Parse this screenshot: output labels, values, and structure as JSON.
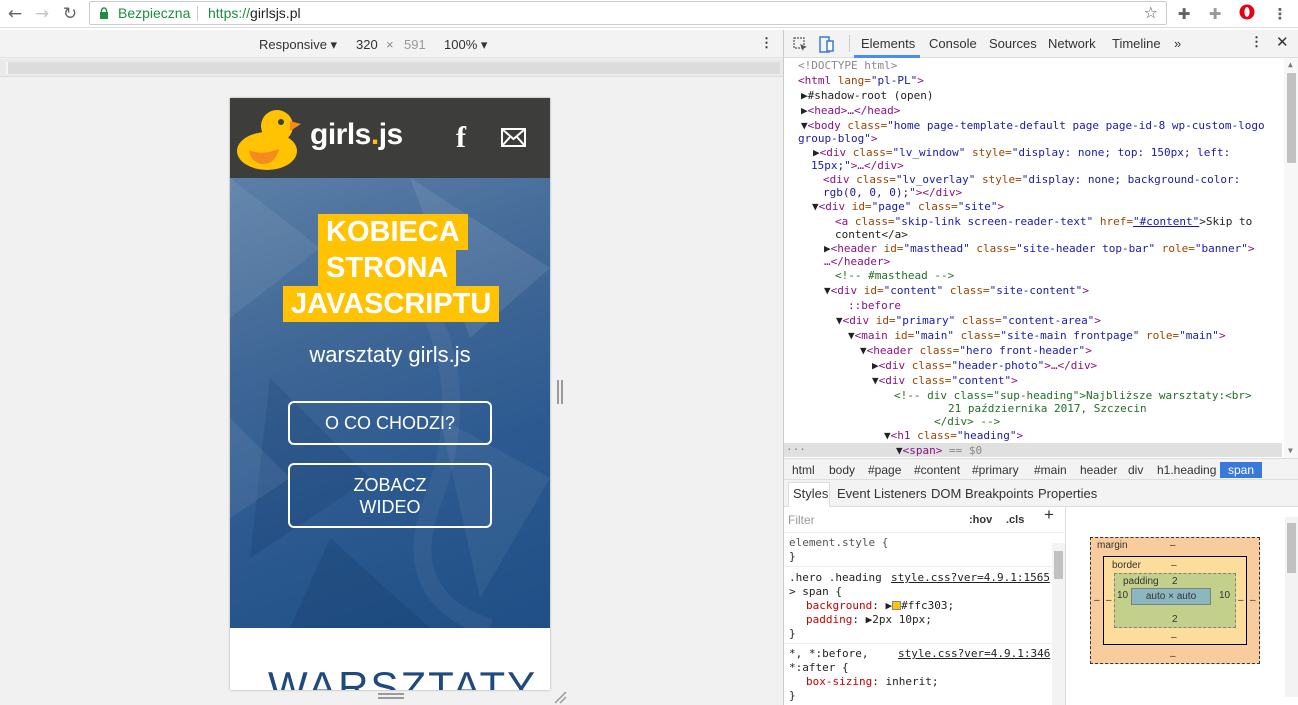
{
  "browser": {
    "secure_label": "Bezpieczna",
    "url_proto": "https://",
    "url_host": "girlsjs.pl"
  },
  "device_toolbar": {
    "device": "Responsive",
    "width": "320",
    "times": "×",
    "height": "591",
    "zoom": "100%"
  },
  "site": {
    "name_pre": "girls",
    "name_dot": ".",
    "name_post": "js",
    "hero_line1": "KOBIECA",
    "hero_line2": "STRONA",
    "hero_line3": "JAVASCRIPTU",
    "subtitle": "warsztaty girls.js",
    "button1": "O CO CHODZI?",
    "button2_line1": "ZOBACZ",
    "button2_line2": "WIDEO",
    "section_title": "WARSZTATY",
    "accent_color": "#ffc303"
  },
  "devtools": {
    "tabs": [
      "Elements",
      "Console",
      "Sources",
      "Network",
      "Timeline"
    ],
    "more": "»",
    "tree": {
      "doctype": "<!DOCTYPE html>",
      "html_open": "<html",
      "html_attr_name": " lang=",
      "html_attr_val": "\"pl-PL\"",
      "html_close": ">",
      "shadow": "#shadow-root (open)",
      "head": "<head>…</head>",
      "body_tag": "<body",
      "body_attr": " class=",
      "body_val1": "\"home page-template-default page page-id-8 wp-custom-logo",
      "body_val2": "group-blog\"",
      "body_close": ">",
      "lv_window_1a": "<div",
      "lv_window_1b": " class=",
      "lv_window_1c": "\"lv_window\"",
      "lv_window_1d": " style=",
      "lv_window_1e": "\"display: none; top: 150px; left:",
      "lv_window_2": "15px;\"",
      "lv_window_2b": ">…</div>",
      "lv_overlay_1a": "<div",
      "lv_overlay_1b": " class=",
      "lv_overlay_1c": "\"lv_overlay\"",
      "lv_overlay_1d": " style=",
      "lv_overlay_1e": "\"display: none; background-color:",
      "lv_overlay_2": "rgb(0, 0, 0);\"",
      "lv_overlay_2b": "></div>",
      "page_a": "<div",
      "page_b": " id=",
      "page_c": "\"page\"",
      "page_d": " class=",
      "page_e": "\"site\"",
      "page_f": ">",
      "skip_a": "<a",
      "skip_b": " class=",
      "skip_c": "\"skip-link screen-reader-text\"",
      "skip_d": " href=",
      "skip_e": "\"#content\"",
      "skip_f": ">Skip to",
      "skip_2": "content</a>",
      "header_a": "<header",
      "header_b": " id=",
      "header_c": "\"masthead\"",
      "header_d": " class=",
      "header_e": "\"site-header top-bar\"",
      "header_f": " role=",
      "header_g": "\"banner\"",
      "header_h": ">",
      "header_2": "…</header>",
      "masthead_comment": "<!-- #masthead -->",
      "content_a": "<div",
      "content_b": " id=",
      "content_c": "\"content\"",
      "content_d": " class=",
      "content_e": "\"site-content\"",
      "content_f": ">",
      "before": "::before",
      "primary_a": "<div",
      "primary_b": " id=",
      "primary_c": "\"primary\"",
      "primary_d": " class=",
      "primary_e": "\"content-area\"",
      "primary_f": ">",
      "main_a": "<main",
      "main_b": " id=",
      "main_c": "\"main\"",
      "main_d": " class=",
      "main_e": "\"site-main frontpage\"",
      "main_f": " role=",
      "main_g": "\"main\"",
      "main_h": ">",
      "hero_a": "<header",
      "hero_b": " class=",
      "hero_c": "\"hero front-header\"",
      "hero_d": ">",
      "photo_a": "<div",
      "photo_b": " class=",
      "photo_c": "\"header-photo\"",
      "photo_d": ">…</div>",
      "contentdiv_a": "<div",
      "contentdiv_b": " class=",
      "contentdiv_c": "\"content\"",
      "contentdiv_d": ">",
      "comment1": "<!-- div class=\"sup-heading\">Najbliższe warsztaty:<br>",
      "comment2": "21 października 2017, Szczecin",
      "comment3": "</div> -->",
      "h1_a": "<h1",
      "h1_b": " class=",
      "h1_c": "\"heading\"",
      "h1_d": ">",
      "span_a": "<span>",
      "span_b": " == $0"
    },
    "crumbs": [
      "html",
      "body",
      "#page",
      "#content",
      "#primary",
      "#main",
      "header",
      "div",
      "h1.heading",
      "span"
    ],
    "style_tabs": [
      "Styles",
      "Event Listeners",
      "DOM Breakpoints",
      "Properties"
    ],
    "filter_placeholder": "Filter",
    "hov": ":hov",
    "cls": ".cls",
    "plus": "+",
    "rules": {
      "element_style": "element.style {",
      "close": "}",
      "rule1_selector": ".hero .heading",
      "rule1_link": "style.css?ver=4.9.1:1565",
      "rule1_selector2": "> span {",
      "rule1_prop1": "background",
      "rule1_val1": "#ffc303;",
      "rule1_prop2": "padding",
      "rule1_val2": "2px 10px;",
      "rule2_selector": "*, *:before,",
      "rule2_link": "style.css?ver=4.9.1:346",
      "rule2_selector2": "*:after {",
      "rule2_prop": "box-sizing",
      "rule2_val": "inherit;"
    },
    "boxmodel": {
      "margin_label": "margin",
      "border_label": "border",
      "padding_label": "padding",
      "dash": "–",
      "padding_top": "2",
      "padding_bottom": "2",
      "padding_left": "10",
      "padding_right": "10",
      "content": "auto × auto"
    }
  }
}
